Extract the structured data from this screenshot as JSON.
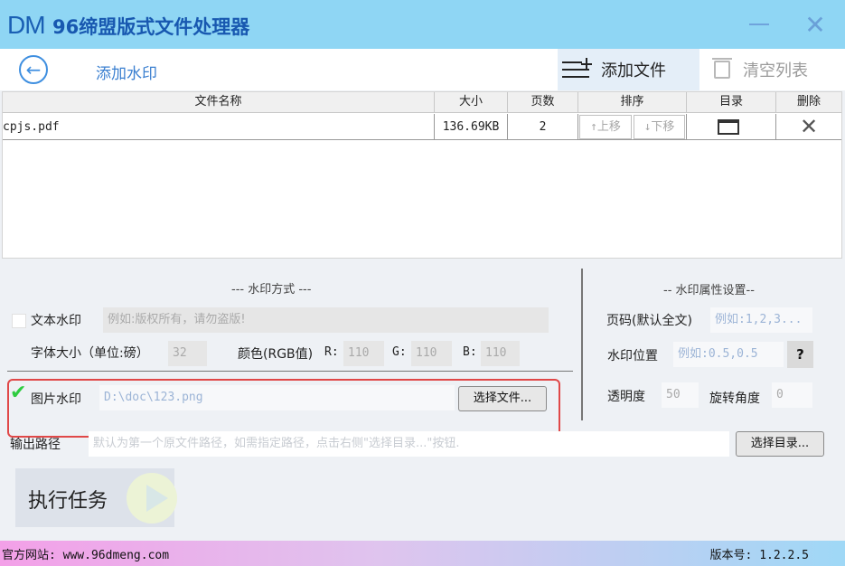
{
  "window": {
    "logo": "DM",
    "title": "96缔盟版式文件处理器",
    "minimize_icon": "minimize-icon",
    "close_icon": "close-icon"
  },
  "toolbar": {
    "back_icon": "back-arrow-icon",
    "page_heading": "添加水印",
    "add_file_label": "添加文件",
    "clear_list_label": "清空列表"
  },
  "table": {
    "headers": [
      "文件名称",
      "大小",
      "页数",
      "排序",
      "目录",
      "删除"
    ],
    "rows": [
      {
        "name": "cpjs.pdf",
        "size": "136.69KB",
        "pages": "2",
        "move_up": "↑上移",
        "move_down": "↓下移"
      }
    ]
  },
  "watermark_mode": {
    "title": "--- 水印方式 ---",
    "text_watermark_label": "文本水印",
    "text_watermark_checked": false,
    "text_placeholder": "例如:版权所有，请勿盗版!",
    "font_size_label": "字体大小（单位:磅）",
    "font_size_value": "32",
    "color_label": "颜色(RGB值)",
    "r_label": "R:",
    "r_value": "110",
    "g_label": "G:",
    "g_value": "110",
    "b_label": "B:",
    "b_value": "110",
    "image_watermark_label": "图片水印",
    "image_watermark_checked": true,
    "image_path": "D:\\doc\\123.png",
    "choose_file_label": "选择文件..."
  },
  "properties": {
    "title": "-- 水印属性设置--",
    "page_range_label": "页码(默认全文)",
    "page_range_placeholder": "例如:1,2,3...",
    "position_label": "水印位置",
    "position_placeholder": "例如:0.5,0.5",
    "help_label": "?",
    "opacity_label": "透明度",
    "opacity_value": "50",
    "rotation_label": "旋转角度",
    "rotation_value": "0"
  },
  "output": {
    "label": "输出路径",
    "placeholder": "默认为第一个原文件路径，如需指定路径，点击右侧\"选择目录...\"按钮.",
    "choose_dir_label": "选择目录..."
  },
  "execute": {
    "label": "执行任务"
  },
  "footer": {
    "website": "官方网站:  www.96dmeng.com",
    "version": "版本号: 1.2.2.5"
  },
  "colors": {
    "titlebar": "#8fd6f4",
    "accent": "#3a7fd0",
    "highlight_border": "#e04848",
    "check": "#2ecc40"
  }
}
